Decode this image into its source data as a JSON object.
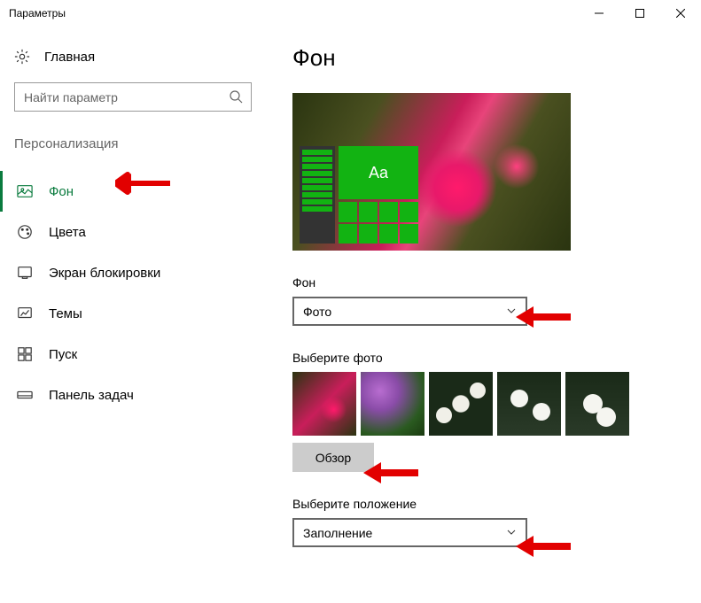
{
  "titlebar": {
    "title": "Параметры"
  },
  "sidebar": {
    "home_label": "Главная",
    "search_placeholder": "Найти параметр",
    "section_title": "Персонализация",
    "items": [
      {
        "label": "Фон"
      },
      {
        "label": "Цвета"
      },
      {
        "label": "Экран блокировки"
      },
      {
        "label": "Темы"
      },
      {
        "label": "Пуск"
      },
      {
        "label": "Панель задач"
      }
    ]
  },
  "main": {
    "heading": "Фон",
    "preview_tile_text": "Aa",
    "background_section_label": "Фон",
    "background_dropdown_value": "Фото",
    "choose_photo_label": "Выберите фото",
    "browse_button_label": "Обзор",
    "position_label": "Выберите положение",
    "position_dropdown_value": "Заполнение"
  },
  "colors": {
    "accent": "#0a7b3e",
    "arrow": "#e20000",
    "tile_green": "#12b312"
  }
}
